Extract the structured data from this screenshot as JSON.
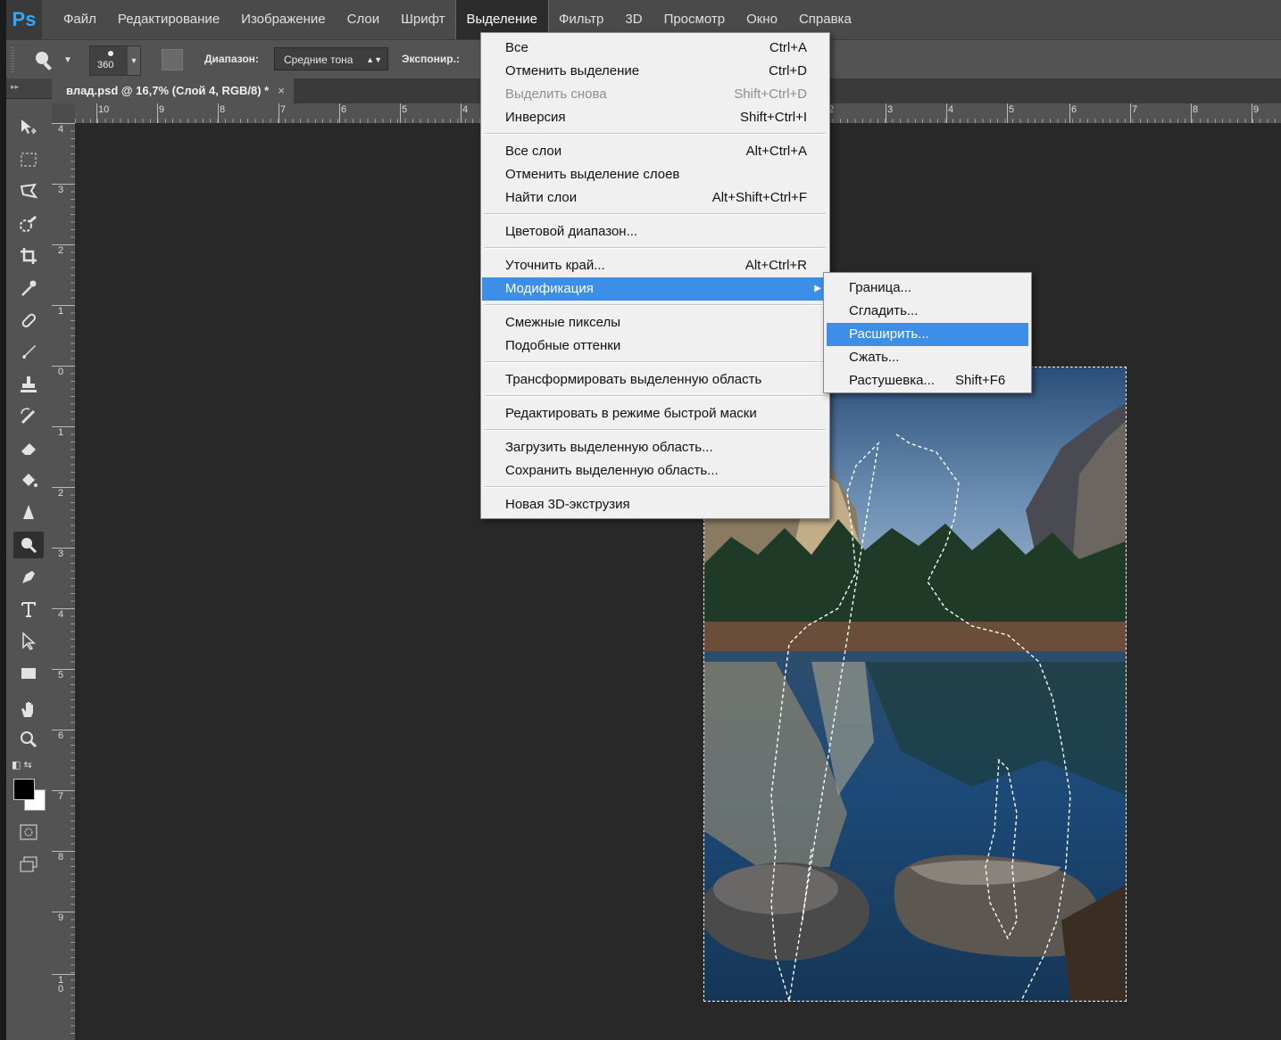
{
  "app": {
    "logo": "Ps"
  },
  "menubar": {
    "items": [
      "Файл",
      "Редактирование",
      "Изображение",
      "Слои",
      "Шрифт",
      "Выделение",
      "Фильтр",
      "3D",
      "Просмотр",
      "Окно",
      "Справка"
    ],
    "active": "Выделение"
  },
  "options": {
    "brush_size": "360",
    "range_label": "Диапазон:",
    "range_value": "Средние тона",
    "exposure_label": "Экспонир.:"
  },
  "document": {
    "tab_title": "влад.psd @ 16,7% (Слой 4, RGB/8) *",
    "close_glyph": "×"
  },
  "ruler_h": [
    "10",
    "9",
    "8",
    "7",
    "6",
    "5",
    "4",
    "2",
    "3",
    "4",
    "5",
    "6",
    "7",
    "8",
    "9"
  ],
  "ruler_v": [
    "4",
    "3",
    "2",
    "1",
    "0",
    "1",
    "2",
    "3",
    "4",
    "5",
    "6",
    "7",
    "8",
    "9",
    "1 0"
  ],
  "select_menu": {
    "items": [
      {
        "label": "Все",
        "shortcut": "Ctrl+A"
      },
      {
        "label": "Отменить выделение",
        "shortcut": "Ctrl+D"
      },
      {
        "label": "Выделить снова",
        "shortcut": "Shift+Ctrl+D",
        "disabled": true
      },
      {
        "label": "Инверсия",
        "shortcut": "Shift+Ctrl+I"
      },
      {
        "label": "Все слои",
        "shortcut": "Alt+Ctrl+A"
      },
      {
        "label": "Отменить выделение слоев",
        "shortcut": ""
      },
      {
        "label": "Найти слои",
        "shortcut": "Alt+Shift+Ctrl+F"
      },
      {
        "label": "Цветовой диапазон...",
        "shortcut": ""
      },
      {
        "label": "Уточнить край...",
        "shortcut": "Alt+Ctrl+R"
      },
      {
        "label": "Модификация",
        "shortcut": "",
        "submenu": true,
        "highlighted": true
      },
      {
        "label": "Смежные пикселы",
        "shortcut": ""
      },
      {
        "label": "Подобные оттенки",
        "shortcut": ""
      },
      {
        "label": "Трансформировать выделенную область",
        "shortcut": ""
      },
      {
        "label": "Редактировать в режиме быстрой маски",
        "shortcut": ""
      },
      {
        "label": "Загрузить выделенную область...",
        "shortcut": ""
      },
      {
        "label": "Сохранить выделенную область...",
        "shortcut": ""
      },
      {
        "label": "Новая 3D-экструзия",
        "shortcut": ""
      }
    ]
  },
  "modify_submenu": {
    "items": [
      {
        "label": "Граница...",
        "shortcut": ""
      },
      {
        "label": "Сгладить...",
        "shortcut": ""
      },
      {
        "label": "Расширить...",
        "shortcut": "",
        "highlighted": true
      },
      {
        "label": "Сжать...",
        "shortcut": ""
      },
      {
        "label": "Растушевка...",
        "shortcut": "Shift+F6"
      }
    ]
  },
  "tools": [
    "move-icon",
    "marquee-icon",
    "lasso-icon",
    "quick-selection-icon",
    "crop-icon",
    "eyedropper-icon",
    "healing-brush-icon",
    "brush-icon",
    "clone-stamp-icon",
    "history-brush-icon",
    "eraser-icon",
    "paint-bucket-icon",
    "sharpen-icon",
    "dodge-icon",
    "pen-icon",
    "type-icon",
    "path-selection-icon",
    "rectangle-icon",
    "hand-icon",
    "zoom-icon"
  ],
  "colors": {
    "foreground": "#000000",
    "background": "#ffffff",
    "accent": "#3d8ee6"
  }
}
